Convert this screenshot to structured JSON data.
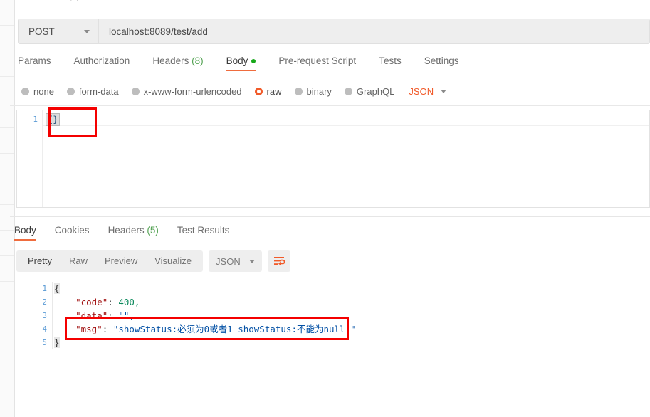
{
  "app": {
    "name": "postman-api-client",
    "top_clip_text": "· ·"
  },
  "request": {
    "method": "POST",
    "url": "localhost:8089/test/add",
    "tabs": [
      {
        "label": "Params",
        "count": "",
        "active": false,
        "dot": false
      },
      {
        "label": "Authorization",
        "count": "",
        "active": false,
        "dot": false
      },
      {
        "label": "Headers",
        "count": "(8)",
        "active": false,
        "dot": false
      },
      {
        "label": "Body",
        "count": "",
        "active": true,
        "dot": true
      },
      {
        "label": "Pre-request Script",
        "count": "",
        "active": false,
        "dot": false
      },
      {
        "label": "Tests",
        "count": "",
        "active": false,
        "dot": false
      },
      {
        "label": "Settings",
        "count": "",
        "active": false,
        "dot": false
      }
    ],
    "body_types": [
      {
        "label": "none",
        "selected": false
      },
      {
        "label": "form-data",
        "selected": false
      },
      {
        "label": "x-www-form-urlencoded",
        "selected": false
      },
      {
        "label": "raw",
        "selected": true
      },
      {
        "label": "binary",
        "selected": false
      },
      {
        "label": "GraphQL",
        "selected": false
      }
    ],
    "format_selected": "JSON",
    "editor": {
      "line_numbers": [
        "1"
      ],
      "content": "{}"
    }
  },
  "response": {
    "tabs": [
      {
        "label": "Body",
        "count": "",
        "active": true
      },
      {
        "label": "Cookies",
        "count": "",
        "active": false
      },
      {
        "label": "Headers",
        "count": "(5)",
        "active": false
      },
      {
        "label": "Test Results",
        "count": "",
        "active": false
      }
    ],
    "view_modes": [
      {
        "label": "Pretty",
        "active": true
      },
      {
        "label": "Raw",
        "active": false
      },
      {
        "label": "Preview",
        "active": false
      },
      {
        "label": "Visualize",
        "active": false
      }
    ],
    "format_selected": "JSON",
    "wrap_icon": "word-wrap-icon",
    "line_numbers": [
      "1",
      "2",
      "3",
      "4",
      "5"
    ],
    "json": {
      "code": "400",
      "data": "",
      "msg": "showStatus:必须为0或者1 showStatus:不能为null "
    },
    "lines": [
      "{",
      "    \"code\": 400,",
      "    \"data\": \"\",",
      "    \"msg\": \"showStatus:必须为0或者1 showStatus:不能为null \"",
      "}"
    ]
  },
  "annotations": [
    {
      "name": "request-body-highlight",
      "color": "#f40000"
    },
    {
      "name": "response-msg-highlight",
      "color": "#f40000"
    }
  ],
  "colors": {
    "accent_orange": "#ef6c3e",
    "selected_radio": "#f15a29",
    "green_badge": "#54a354",
    "green_dot": "#17a81a",
    "annotation_red": "#f40000",
    "json_key": "#a31515",
    "json_number": "#09885a",
    "json_string": "#0451a5"
  }
}
